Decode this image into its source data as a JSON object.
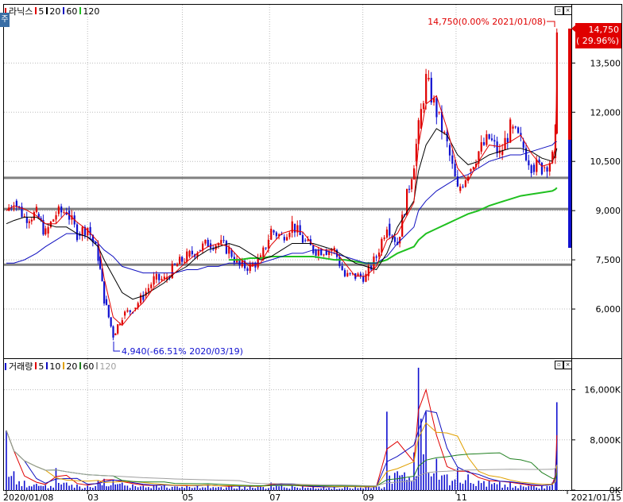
{
  "price_panel": {
    "legend": {
      "name": "라닉스",
      "ma_items": [
        {
          "label": "5",
          "color": "#e00000"
        },
        {
          "label": "20",
          "color": "#000000"
        },
        {
          "label": "60",
          "color": "#1010c0"
        },
        {
          "label": "120",
          "color": "#20c020"
        }
      ]
    },
    "side_tab": "주",
    "last_price_label": "14,750",
    "last_change_label": "( 29.96%)",
    "high_annotation": "14,750(0.00% 2021/01/08)",
    "low_annotation": "4,940(-66.51% 2020/03/19)"
  },
  "volume_panel": {
    "legend": {
      "name": "거래량",
      "ma_items": [
        {
          "label": "5",
          "color": "#e00000"
        },
        {
          "label": "10",
          "color": "#1010c0"
        },
        {
          "label": "20",
          "color": "#e0a000"
        },
        {
          "label": "60",
          "color": "#208020"
        },
        {
          "label": "120",
          "color": "#a0a0a0"
        }
      ]
    }
  },
  "colors": {
    "up": "#e00000",
    "down": "#1010d0",
    "support_line": "#808080"
  },
  "chart_data": [
    {
      "type": "candlestick",
      "title": "라닉스",
      "x_range": [
        "2020/01/08",
        "2021/01/15"
      ],
      "x_ticks": [
        "2020/01/08",
        "03",
        "05",
        "07",
        "09",
        "11",
        "2021/01/15"
      ],
      "y_ticks": [
        6000,
        7500,
        9000,
        10500,
        12000,
        13500
      ],
      "y_tick_labels": [
        "6,000",
        "7,500",
        "9,000",
        "10,500",
        "12,000",
        "13,500"
      ],
      "ylim": [
        4500,
        15300
      ],
      "horizontal_lines": [
        10000,
        9050,
        7350
      ],
      "close_series": [
        [
          "2020/01/08",
          9000
        ],
        [
          "2020/01/13",
          9300
        ],
        [
          "2020/01/20",
          8800
        ],
        [
          "2020/01/28",
          8900
        ],
        [
          "2020/02/03",
          8300
        ],
        [
          "2020/02/10",
          8900
        ],
        [
          "2020/02/17",
          9000
        ],
        [
          "2020/02/24",
          8300
        ],
        [
          "2020/03/02",
          8500
        ],
        [
          "2020/03/09",
          7600
        ],
        [
          "2020/03/13",
          6300
        ],
        [
          "2020/03/19",
          5200
        ],
        [
          "2020/03/25",
          5800
        ],
        [
          "2020/04/01",
          6000
        ],
        [
          "2020/04/08",
          6400
        ],
        [
          "2020/04/15",
          6900
        ],
        [
          "2020/04/22",
          6900
        ],
        [
          "2020/04/29",
          7300
        ],
        [
          "2020/05/07",
          7600
        ],
        [
          "2020/05/14",
          7800
        ],
        [
          "2020/05/21",
          8000
        ],
        [
          "2020/05/28",
          8000
        ],
        [
          "2020/06/04",
          7800
        ],
        [
          "2020/06/11",
          7300
        ],
        [
          "2020/06/18",
          7300
        ],
        [
          "2020/06/25",
          7500
        ],
        [
          "2020/07/02",
          8400
        ],
        [
          "2020/07/09",
          8200
        ],
        [
          "2020/07/16",
          8600
        ],
        [
          "2020/07/23",
          8100
        ],
        [
          "2020/07/30",
          7800
        ],
        [
          "2020/08/06",
          7800
        ],
        [
          "2020/08/13",
          7800
        ],
        [
          "2020/08/20",
          7000
        ],
        [
          "2020/08/27",
          7000
        ],
        [
          "2020/09/03",
          7000
        ],
        [
          "2020/09/10",
          7600
        ],
        [
          "2020/09/17",
          8600
        ],
        [
          "2020/09/24",
          8000
        ],
        [
          "2020/10/05",
          10500
        ],
        [
          "2020/10/08",
          11500
        ],
        [
          "2020/10/13",
          13000
        ],
        [
          "2020/10/20",
          12000
        ],
        [
          "2020/10/27",
          11000
        ],
        [
          "2020/11/03",
          9600
        ],
        [
          "2020/11/10",
          10200
        ],
        [
          "2020/11/17",
          10800
        ],
        [
          "2020/11/24",
          11200
        ],
        [
          "2020/12/01",
          10700
        ],
        [
          "2020/12/08",
          11500
        ],
        [
          "2020/12/15",
          11100
        ],
        [
          "2020/12/22",
          10400
        ],
        [
          "2020/12/29",
          10300
        ],
        [
          "2021/01/05",
          10600
        ],
        [
          "2021/01/07",
          11350
        ],
        [
          "2021/01/08",
          14750
        ]
      ],
      "moving_averages": {
        "ma20": [
          8600,
          8700,
          8800,
          8800,
          8600,
          8500,
          8500,
          8300,
          8200,
          7900,
          7500,
          7000,
          6500,
          6300,
          6400,
          6600,
          6800,
          7100,
          7300,
          7600,
          7800,
          7900,
          8000,
          7900,
          7700,
          7500,
          7600,
          7800,
          8000,
          8000,
          8000,
          7900,
          7800,
          7600,
          7400,
          7300,
          7200,
          7700,
          8500,
          9300,
          10200,
          11000,
          11500,
          11300,
          10700,
          10400,
          10500,
          10700,
          10800,
          10900,
          10900,
          10800,
          10600,
          10500,
          10700,
          10900
        ],
        "ma60": [
          7400,
          7400,
          7500,
          7700,
          7900,
          8100,
          8300,
          8300,
          8200,
          8000,
          7800,
          7600,
          7300,
          7200,
          7100,
          7100,
          7100,
          7100,
          7200,
          7200,
          7300,
          7300,
          7400,
          7400,
          7400,
          7400,
          7500,
          7600,
          7700,
          7700,
          7800,
          7800,
          7700,
          7600,
          7500,
          7400,
          7400,
          7600,
          8000,
          8500,
          9000,
          9300,
          9600,
          9800,
          10000,
          10100,
          10300,
          10500,
          10600,
          10700,
          10700,
          10800,
          10900,
          11000,
          11100,
          11100
        ],
        "ma120": [
          null,
          null,
          null,
          null,
          null,
          null,
          null,
          null,
          null,
          null,
          null,
          null,
          null,
          null,
          null,
          null,
          null,
          null,
          null,
          null,
          null,
          null,
          7500,
          7500,
          7550,
          7550,
          7600,
          7600,
          7600,
          7600,
          7600,
          7550,
          7500,
          7500,
          7450,
          7400,
          7400,
          7500,
          7700,
          7900,
          8100,
          8300,
          8450,
          8600,
          8750,
          8900,
          9000,
          9150,
          9250,
          9350,
          9450,
          9500,
          9550,
          9600,
          9650,
          9700
        ]
      }
    },
    {
      "type": "bar",
      "title": "거래량",
      "y_ticks": [
        0,
        8000,
        16000
      ],
      "y_tick_labels": [
        "0K",
        "8,000K",
        "16,000K"
      ],
      "ylim": [
        0,
        20000
      ],
      "volume_series": [
        [
          "2020/01/08",
          9500
        ],
        [
          "2020/01/13",
          3000
        ],
        [
          "2020/01/20",
          1500
        ],
        [
          "2020/01/28",
          1000
        ],
        [
          "2020/02/03",
          800
        ],
        [
          "2020/02/10",
          3500
        ],
        [
          "2020/02/17",
          1200
        ],
        [
          "2020/02/24",
          900
        ],
        [
          "2020/03/02",
          700
        ],
        [
          "2020/03/09",
          1500
        ],
        [
          "2020/03/13",
          1800
        ],
        [
          "2020/03/19",
          1500
        ],
        [
          "2020/03/25",
          1200
        ],
        [
          "2020/04/01",
          900
        ],
        [
          "2020/04/08",
          700
        ],
        [
          "2020/04/15",
          800
        ],
        [
          "2020/04/22",
          900
        ],
        [
          "2020/04/29",
          600
        ],
        [
          "2020/05/07",
          800
        ],
        [
          "2020/05/14",
          700
        ],
        [
          "2020/05/21",
          900
        ],
        [
          "2020/05/28",
          500
        ],
        [
          "2020/06/04",
          700
        ],
        [
          "2020/06/11",
          600
        ],
        [
          "2020/06/18",
          600
        ],
        [
          "2020/06/25",
          600
        ],
        [
          "2020/07/02",
          1200
        ],
        [
          "2020/07/09",
          900
        ],
        [
          "2020/07/16",
          700
        ],
        [
          "2020/07/23",
          600
        ],
        [
          "2020/07/30",
          500
        ],
        [
          "2020/08/06",
          500
        ],
        [
          "2020/08/13",
          500
        ],
        [
          "2020/08/20",
          700
        ],
        [
          "2020/08/27",
          500
        ],
        [
          "2020/09/03",
          500
        ],
        [
          "2020/09/10",
          600
        ],
        [
          "2020/09/17",
          12500
        ],
        [
          "2020/09/24",
          3000
        ],
        [
          "2020/10/05",
          6000
        ],
        [
          "2020/10/08",
          19500
        ],
        [
          "2020/10/13",
          12500
        ],
        [
          "2020/10/20",
          5000
        ],
        [
          "2020/10/27",
          2500
        ],
        [
          "2020/11/03",
          3500
        ],
        [
          "2020/11/10",
          2500
        ],
        [
          "2020/11/17",
          1500
        ],
        [
          "2020/11/24",
          1500
        ],
        [
          "2020/12/01",
          1300
        ],
        [
          "2020/12/08",
          1200
        ],
        [
          "2020/12/15",
          800
        ],
        [
          "2020/12/22",
          700
        ],
        [
          "2020/12/29",
          700
        ],
        [
          "2021/01/05",
          1200
        ],
        [
          "2021/01/07",
          3500
        ],
        [
          "2021/01/08",
          14000
        ]
      ]
    }
  ]
}
